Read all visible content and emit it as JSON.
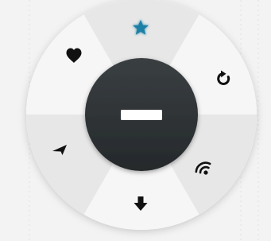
{
  "menu": {
    "colors": {
      "page_background": "#f3f3f3",
      "ring_light": "#f6f6f6",
      "ring_dark": "#e7e7e7",
      "hub": "#2f3335",
      "hub_symbol": "#ffffff",
      "icon": "#111111",
      "icon_active": "#1b7fa6"
    },
    "center_button": {
      "icon": "minus-icon",
      "state": "collapse"
    },
    "items": [
      {
        "id": "favorite",
        "icon": "star-icon",
        "active": true
      },
      {
        "id": "refresh",
        "icon": "refresh-icon",
        "active": false
      },
      {
        "id": "wireless",
        "icon": "wifi-icon",
        "active": false
      },
      {
        "id": "download",
        "icon": "download-icon",
        "active": false
      },
      {
        "id": "navigate",
        "icon": "location-arrow-icon",
        "active": false
      },
      {
        "id": "like",
        "icon": "heart-icon",
        "active": false
      }
    ]
  }
}
